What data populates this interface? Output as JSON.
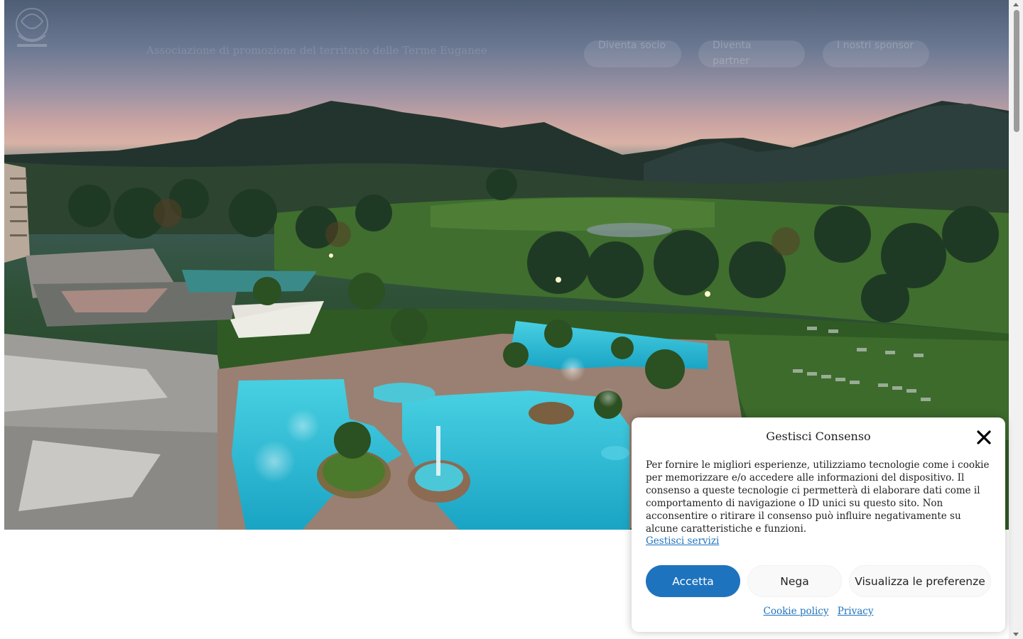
{
  "header": {
    "tagline": "Associazione di promozione del territorio delle Terme Euganee",
    "nav": [
      {
        "label": "Diventa socio"
      },
      {
        "label": "Diventa partner"
      },
      {
        "label": "I nostri sponsor"
      }
    ]
  },
  "hero": {
    "image_description_icon": "hero-landscape-image"
  },
  "consent": {
    "title": "Gestisci Consenso",
    "body": "Per fornire le migliori esperienze, utilizziamo tecnologie come i cookie per memorizzare e/o accedere alle informazioni del dispositivo. Il consenso a queste tecnologie ci permetterà di elaborare dati come il comportamento di navigazione o ID unici su questo sito. Non acconsentire o ritirare il consenso può influire negativamente su alcune caratteristiche e funzioni.",
    "manage_link": "Gestisci servizi",
    "accept_label": "Accetta",
    "deny_label": "Nega",
    "prefs_label": "Visualizza le preferenze",
    "cookie_policy_label": "Cookie policy",
    "privacy_label": "Privacy"
  },
  "colors": {
    "accent": "#1e73be",
    "pool": "#2bb7d0"
  }
}
